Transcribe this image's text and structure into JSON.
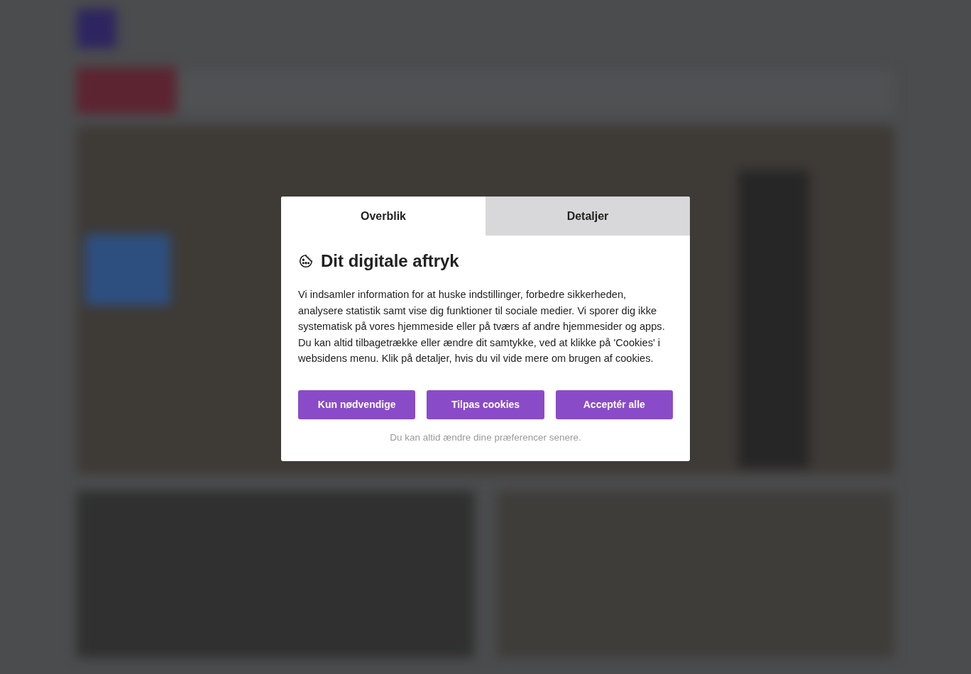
{
  "dialog": {
    "tabs": [
      {
        "label": "Overblik",
        "selected": true
      },
      {
        "label": "Detaljer",
        "selected": false
      }
    ],
    "title": "Dit digitale aftryk",
    "body": "Vi indsamler information for at huske indstillinger, forbedre sikkerheden, analysere statistik samt vise dig funktioner til sociale medier. Vi sporer dig ikke systematisk på vores hjemmeside eller på tværs af andre hjemmesider og apps. Du kan altid tilbagetrække eller ændre dit samtykke, ved at klikke på 'Cookies' i websidens menu. Klik på detaljer, hvis du vil vide mere om brugen af cookies.",
    "buttons": [
      "Kun nødvendige",
      "Tilpas cookies",
      "Acceptér alle"
    ],
    "footnote": "Du kan altid ændre dine præferencer senere."
  }
}
